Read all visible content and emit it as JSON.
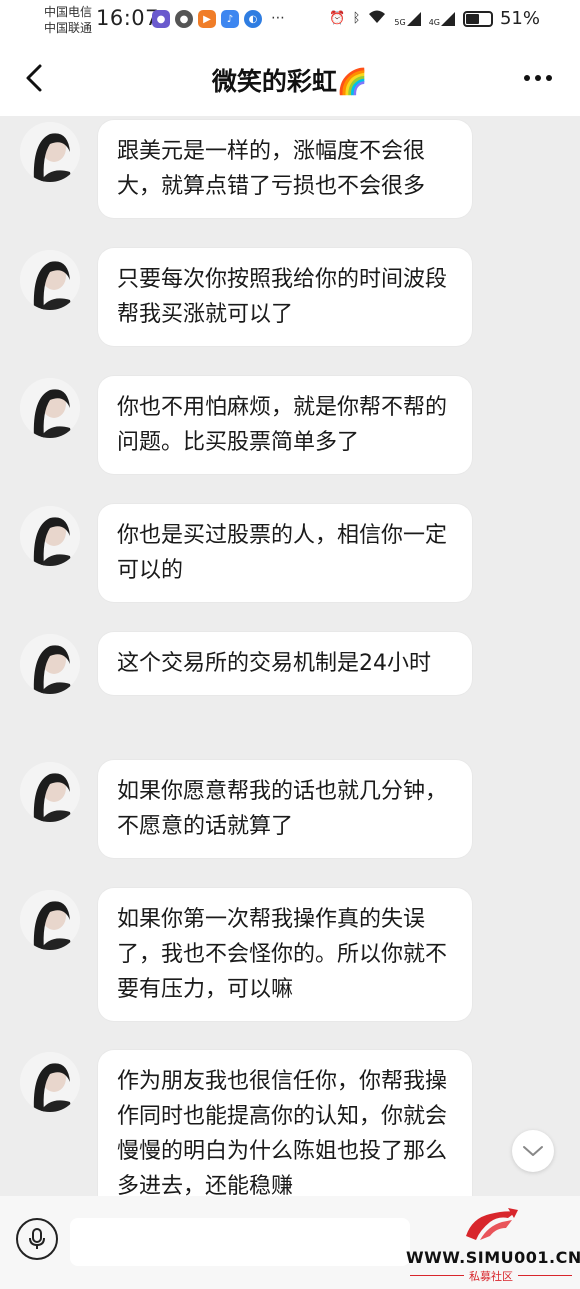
{
  "status_bar": {
    "carrier1": "中国电信",
    "carrier2": "中国联通",
    "time": "16:07",
    "net1": "5G",
    "net2": "4G",
    "battery": "51%"
  },
  "header": {
    "title": "微笑的彩虹🌈"
  },
  "messages": [
    {
      "text": "跟美元是一样的，涨幅度不会很大，就算点错了亏损也不会很多"
    },
    {
      "text": "只要每次你按照我给你的时间波段帮我买涨就可以了"
    },
    {
      "text": "你也不用怕麻烦，就是你帮不帮的问题。比买股票简单多了"
    },
    {
      "text": "你也是买过股票的人，相信你一定可以的"
    },
    {
      "text": "这个交易所的交易机制是24小时"
    },
    {
      "text": "如果你愿意帮我的话也就几分钟，不愿意的话就算了"
    },
    {
      "text": "如果你第一次帮我操作真的失误了，我也不会怪你的。所以你就不要有压力，可以嘛"
    },
    {
      "text": "作为朋友我也很信任你，你帮我操作同时也能提高你的认知，你就会慢慢的明白为什么陈姐也投了那么多进去，还能稳赚"
    }
  ],
  "input": {
    "placeholder": ""
  },
  "watermark": {
    "url": "WWW.SIMU001.CN",
    "subtitle": "私募社区"
  },
  "colors": {
    "chat_bg": "#ededed",
    "bubble_bg": "#ffffff",
    "watermark_red": "#d8262c"
  }
}
